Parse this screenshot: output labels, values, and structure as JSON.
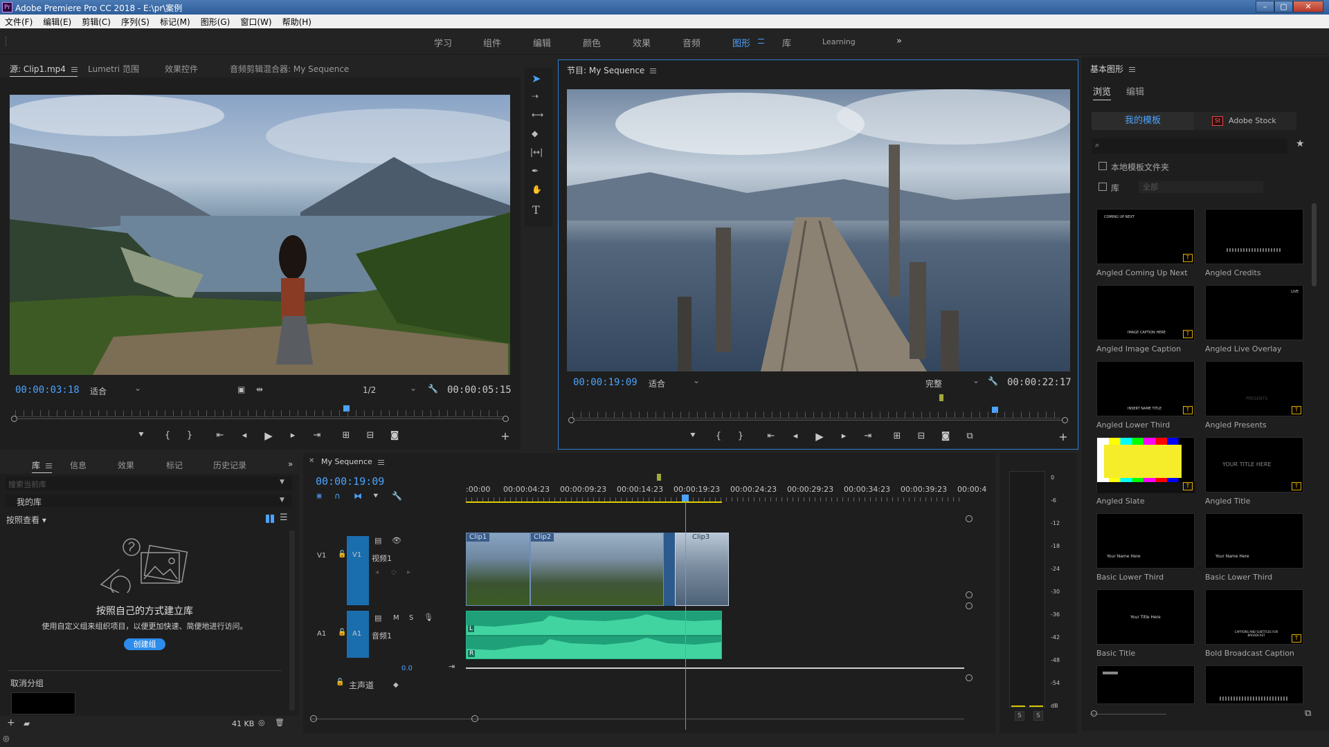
{
  "window": {
    "title": "Adobe Premiere Pro CC 2018 - E:\\pr\\案例",
    "app_icon": "Pr"
  },
  "menu": [
    "文件(F)",
    "编辑(E)",
    "剪辑(C)",
    "序列(S)",
    "标记(M)",
    "图形(G)",
    "窗口(W)",
    "帮助(H)"
  ],
  "workspaces": [
    "学习",
    "组件",
    "编辑",
    "颜色",
    "效果",
    "音频",
    "图形",
    "库",
    "Learning"
  ],
  "workspace_active": "图形",
  "source": {
    "tabs": [
      "源: Clip1.mp4",
      "Lumetri 范围",
      "效果控件",
      "音频剪辑混合器: My Sequence"
    ],
    "timecode": "00:00:03:18",
    "fit": "适合",
    "resolution": "1/2",
    "duration": "00:00:05:15"
  },
  "program": {
    "tab": "节目: My Sequence",
    "timecode": "00:00:19:09",
    "fit": "适合",
    "quality": "完整",
    "duration": "00:00:22:17"
  },
  "essential_graphics": {
    "title": "基本图形",
    "tabs": [
      "浏览",
      "编辑"
    ],
    "sources": [
      "我的模板",
      "Adobe Stock"
    ],
    "stock_icon": "St",
    "check_local": "本地模板文件夹",
    "check_library": "库",
    "library_select": "全部",
    "templates": [
      {
        "name": "Angled Coming Up Next",
        "thumb_text": "COMING UP NEXT"
      },
      {
        "name": "Angled Credits",
        "thumb_text": ""
      },
      {
        "name": "Angled Image Caption",
        "thumb_text": "IMAGE CAPTION HERE"
      },
      {
        "name": "Angled Live Overlay",
        "thumb_text": "LIVE"
      },
      {
        "name": "Angled Lower Third",
        "thumb_text": "INSERT NAME TITLE"
      },
      {
        "name": "Angled Presents",
        "thumb_text": "PRESENTS"
      },
      {
        "name": "Angled Slate",
        "thumb_text": ""
      },
      {
        "name": "Angled Title",
        "thumb_text": "YOUR TITLE HERE"
      },
      {
        "name": "Basic Lower Third",
        "thumb_text": "Your Name Here"
      },
      {
        "name": "Basic Lower Third",
        "thumb_text": "Your Name Here"
      },
      {
        "name": "Basic Title",
        "thumb_text": "Your Title Here"
      },
      {
        "name": "Bold Broadcast Caption",
        "thumb_text": "CAPTIONS AND SUBTITLES FOR BROADCAST"
      }
    ]
  },
  "library": {
    "tabs": [
      "库",
      "信息",
      "效果",
      "标记",
      "历史记录"
    ],
    "search_placeholder": "搜索当前库",
    "my_library": "我的库",
    "group_view": "按照查看",
    "empty_title": "按照自己的方式建立库",
    "empty_desc": "使用自定义组来组织项目，以便更加快速、简便地进行访问。",
    "create_group": "创建组",
    "ungroup": "取消分组",
    "size": "41 KB"
  },
  "timeline": {
    "tab": "My Sequence",
    "timecode": "00:00:19:09",
    "ruler": [
      ":00:00",
      "00:00:04:23",
      "00:00:09:23",
      "00:00:14:23",
      "00:00:19:23",
      "00:00:24:23",
      "00:00:29:23",
      "00:00:34:23",
      "00:00:39:23",
      "00:00:4"
    ],
    "video_track": {
      "id": "V1",
      "patch": "V1",
      "name": "视频1"
    },
    "audio_track": {
      "id": "A1",
      "patch": "A1",
      "name": "音频1",
      "m": "M",
      "s": "S"
    },
    "master": {
      "name": "主声道",
      "value": "0.0"
    },
    "clips": [
      "Clip1",
      "Clip2",
      "Clip3"
    ],
    "audio_channels": [
      "L",
      "R"
    ]
  },
  "meter": {
    "scale": [
      "0",
      "-6",
      "-12",
      "-18",
      "-24",
      "-30",
      "-36",
      "-42",
      "-48",
      "-54",
      "dB"
    ],
    "solo": [
      "S",
      "S"
    ]
  }
}
